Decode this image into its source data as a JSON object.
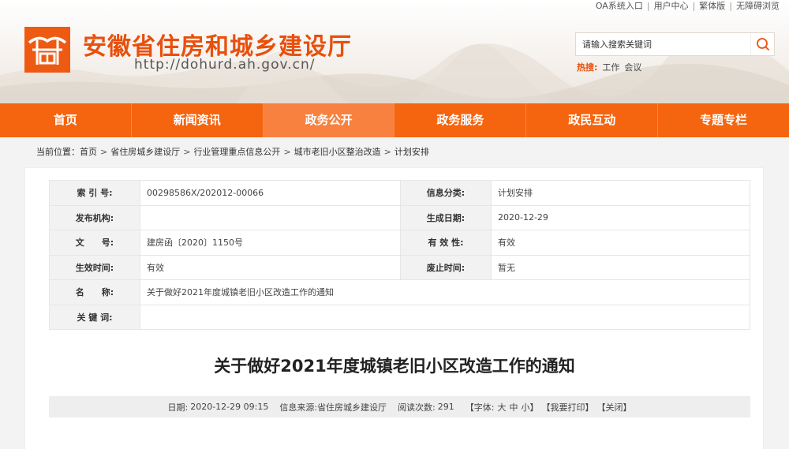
{
  "top_links": [
    "OA系统入口",
    "用户中心",
    "繁体版",
    "无障碍浏览"
  ],
  "site": {
    "title": "安徽省住房和城乡建设厅",
    "url": "http://dohurd.ah.gov.cn/"
  },
  "search": {
    "placeholder": "请输入搜索关键词",
    "hot_label": "热搜:",
    "hot_words": [
      "工作",
      "会议"
    ]
  },
  "nav": {
    "items": [
      "首页",
      "新闻资讯",
      "政务公开",
      "政务服务",
      "政民互动",
      "专题专栏"
    ],
    "active_index": 2
  },
  "breadcrumb": {
    "prefix": "当前位置：",
    "items": [
      "首页",
      "省住房城乡建设厅",
      "行业管理重点信息公开",
      "城市老旧小区整治改造",
      "计划安排"
    ]
  },
  "meta": {
    "rows": [
      {
        "k1": "索 引 号:",
        "v1": "00298586X/202012-00066",
        "k2": "信息分类:",
        "v2": "计划安排"
      },
      {
        "k1": "发布机构:",
        "v1": "",
        "k2": "生成日期:",
        "v2": "2020-12-29"
      },
      {
        "k1": "文　　号:",
        "v1": "建房函〔2020〕1150号",
        "k2": "有 效 性:",
        "v2": "有效"
      },
      {
        "k1": "生效时间:",
        "v1": "有效",
        "k2": "废止时间:",
        "v2": "暂无"
      }
    ],
    "name_label": "名　　称:",
    "name_value": "关于做好2021年度城镇老旧小区改造工作的通知",
    "keywords_label": "关 键 词:",
    "keywords_value": ""
  },
  "article": {
    "title": "关于做好2021年度城镇老旧小区改造工作的通知",
    "date_label": "日期:",
    "date": "2020-12-29 09:15",
    "source_label": "信息来源:",
    "source": "省住房城乡建设厅",
    "views_label": "阅读次数:",
    "views": "291",
    "font_label": "【字体:",
    "font_sizes": [
      "大",
      "中",
      "小"
    ],
    "font_close": "】",
    "print": "【我要打印】",
    "close": "【关闭】"
  },
  "colors": {
    "brand": "#f5640f",
    "nav_active": "#f88140",
    "title": "#e8500d"
  }
}
